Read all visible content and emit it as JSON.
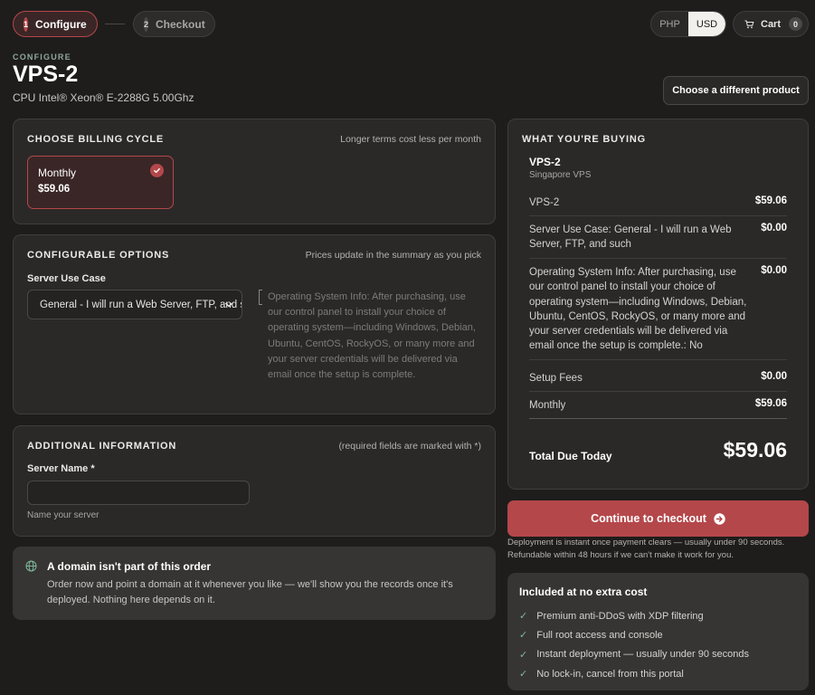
{
  "steps": [
    {
      "num": "1",
      "label": "Configure"
    },
    {
      "num": "2",
      "label": "Checkout"
    }
  ],
  "currency": {
    "options": [
      "PHP",
      "USD"
    ],
    "selected": "USD"
  },
  "cart": {
    "label": "Cart",
    "count": "0"
  },
  "header": {
    "eyebrow": "CONFIGURE",
    "title": "VPS-2",
    "subtitle": "CPU Intel® Xeon® E-2288G 5.00Ghz",
    "change_product_label": "Choose a different product"
  },
  "billing": {
    "heading": "CHOOSE BILLING CYCLE",
    "note": "Longer terms cost less per month",
    "option": {
      "name": "Monthly",
      "price": "$59.06",
      "selected": true
    }
  },
  "options": {
    "heading": "CONFIGURABLE OPTIONS",
    "note": "Prices update in the summary as you pick",
    "use_case_label": "Server Use Case",
    "use_case_value": "General - I will run a Web Server, FTP, and such",
    "os_info": "Operating System Info: After purchasing, use our control panel to install your choice of operating system—including Windows, Debian, Ubuntu, CentOS, RockyOS, or many more and your server credentials will be delivered via email once the setup is complete."
  },
  "additional": {
    "heading": "ADDITIONAL INFORMATION",
    "note": "(required fields are marked with *)",
    "server_name_label": "Server Name *",
    "server_name_value": "",
    "server_name_hint": "Name your server"
  },
  "domain_notice": {
    "title": "A domain isn't part of this order",
    "text": "Order now and point a domain at it whenever you like — we'll show you the records once it's deployed. Nothing here depends on it."
  },
  "summary": {
    "heading": "WHAT YOU'RE BUYING",
    "product": "VPS-2",
    "group": "Singapore VPS",
    "lines": [
      {
        "label": "VPS-2",
        "value": "$59.06"
      },
      {
        "label": "Server Use Case: General - I will run a Web Server, FTP, and such",
        "value": "$0.00"
      },
      {
        "label": "Operating System Info: After purchasing, use our control panel to install your choice of operating system—including Windows, Debian, Ubuntu, CentOS, RockyOS, or many more and your server credentials will be delivered via email once the setup is complete.: No",
        "value": "$0.00"
      },
      {
        "label": "Setup Fees",
        "value": "$0.00"
      },
      {
        "label": "Monthly",
        "value": "$59.06"
      }
    ],
    "total_label": "Total Due Today",
    "total_value": "$59.06"
  },
  "checkout": {
    "button_label": "Continue to checkout",
    "fine_print": "Deployment is instant once payment clears — usually under 90 seconds. Refundable within 48 hours if we can't make it work for you."
  },
  "included": {
    "title": "Included at no extra cost",
    "items": [
      "Premium anti-DDoS with XDP filtering",
      "Full root access and console",
      "Instant deployment — usually under 90 seconds",
      "No lock-in, cancel from this portal"
    ]
  },
  "colors": {
    "accent": "#b4474a",
    "background": "#1e1d1c",
    "card": "#2a2928",
    "check_green": "#7fb89b"
  },
  "icons": [
    "cart-icon",
    "check-icon",
    "chevron-down-icon",
    "globe-icon",
    "arrow-right-circle-icon",
    "checkmark-icon"
  ]
}
